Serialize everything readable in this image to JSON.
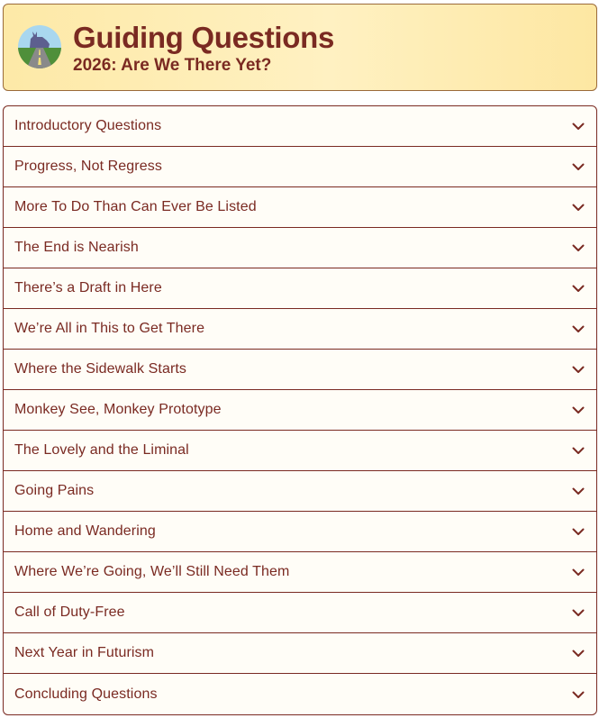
{
  "header": {
    "title": "Guiding Questions",
    "subtitle": "2026: Are We There Yet?",
    "logo_icon": "road-rabbit-logo-icon"
  },
  "colors": {
    "text": "#7a2a22",
    "header_bg": "#fde9a7",
    "border": "#7a2a22",
    "panel_bg": "#fffdf7"
  },
  "accordion": {
    "items": [
      {
        "label": "Introductory Questions"
      },
      {
        "label": "Progress, Not Regress"
      },
      {
        "label": "More To Do Than Can Ever Be Listed"
      },
      {
        "label": "The End is Nearish"
      },
      {
        "label": "There’s a Draft in Here"
      },
      {
        "label": "We’re All in This to Get There"
      },
      {
        "label": "Where the Sidewalk Starts"
      },
      {
        "label": "Monkey See, Monkey Prototype"
      },
      {
        "label": "The Lovely and the Liminal"
      },
      {
        "label": "Going Pains"
      },
      {
        "label": "Home and Wandering"
      },
      {
        "label": "Where We’re Going, We’ll Still Need Them"
      },
      {
        "label": "Call of Duty-Free"
      },
      {
        "label": "Next Year in Futurism"
      },
      {
        "label": "Concluding Questions"
      }
    ],
    "expand_icon": "chevron-down-icon"
  }
}
